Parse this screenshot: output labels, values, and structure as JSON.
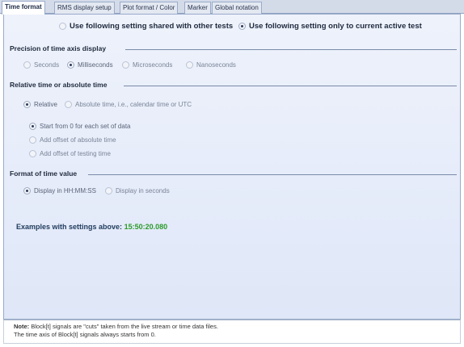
{
  "tabs": [
    {
      "label": "Time format",
      "active": true
    },
    {
      "label": "RMS display setup",
      "active": false
    },
    {
      "label": "Plot format / Color",
      "active": false
    },
    {
      "label": "Marker",
      "active": false
    },
    {
      "label": "Global notation",
      "active": false
    }
  ],
  "scope": {
    "shared_label": "Use following setting shared with other tests",
    "shared_selected": false,
    "current_label": "Use following setting only to current active test",
    "current_selected": true
  },
  "precision": {
    "title": "Precision of time axis display",
    "options": [
      "Seconds",
      "Milliseconds",
      "Microseconds",
      "Nanoseconds"
    ],
    "selected": "Milliseconds"
  },
  "relative": {
    "title": "Relative time or absolute time",
    "relative_label": "Relative",
    "absolute_label": "Absolute time, i.e., calendar time or UTC",
    "selected": "Relative",
    "sub_options": [
      "Start from 0 for each set of data",
      "Add offset of absolute time",
      "Add offset of testing time"
    ],
    "sub_selected": "Start from 0 for each set of data"
  },
  "format": {
    "title": "Format of time value",
    "options": [
      "Display in HH:MM:SS",
      "Display in seconds"
    ],
    "selected": "Display in HH:MM:SS"
  },
  "examples": {
    "label": "Examples with settings above:",
    "value": "15:50:20.080"
  },
  "note": {
    "bold": "Note:",
    "line1": "Block[t] signals are \"cuts\" taken from the live stream or time data files.",
    "line2": "The time axis of Block[t] signals always starts from 0."
  },
  "colors": {
    "accent_green": "#2c9a2a",
    "panel_top": "#eef2fb",
    "panel_bottom": "#dfe7f8",
    "tab_strip": "#d4dbe8"
  }
}
